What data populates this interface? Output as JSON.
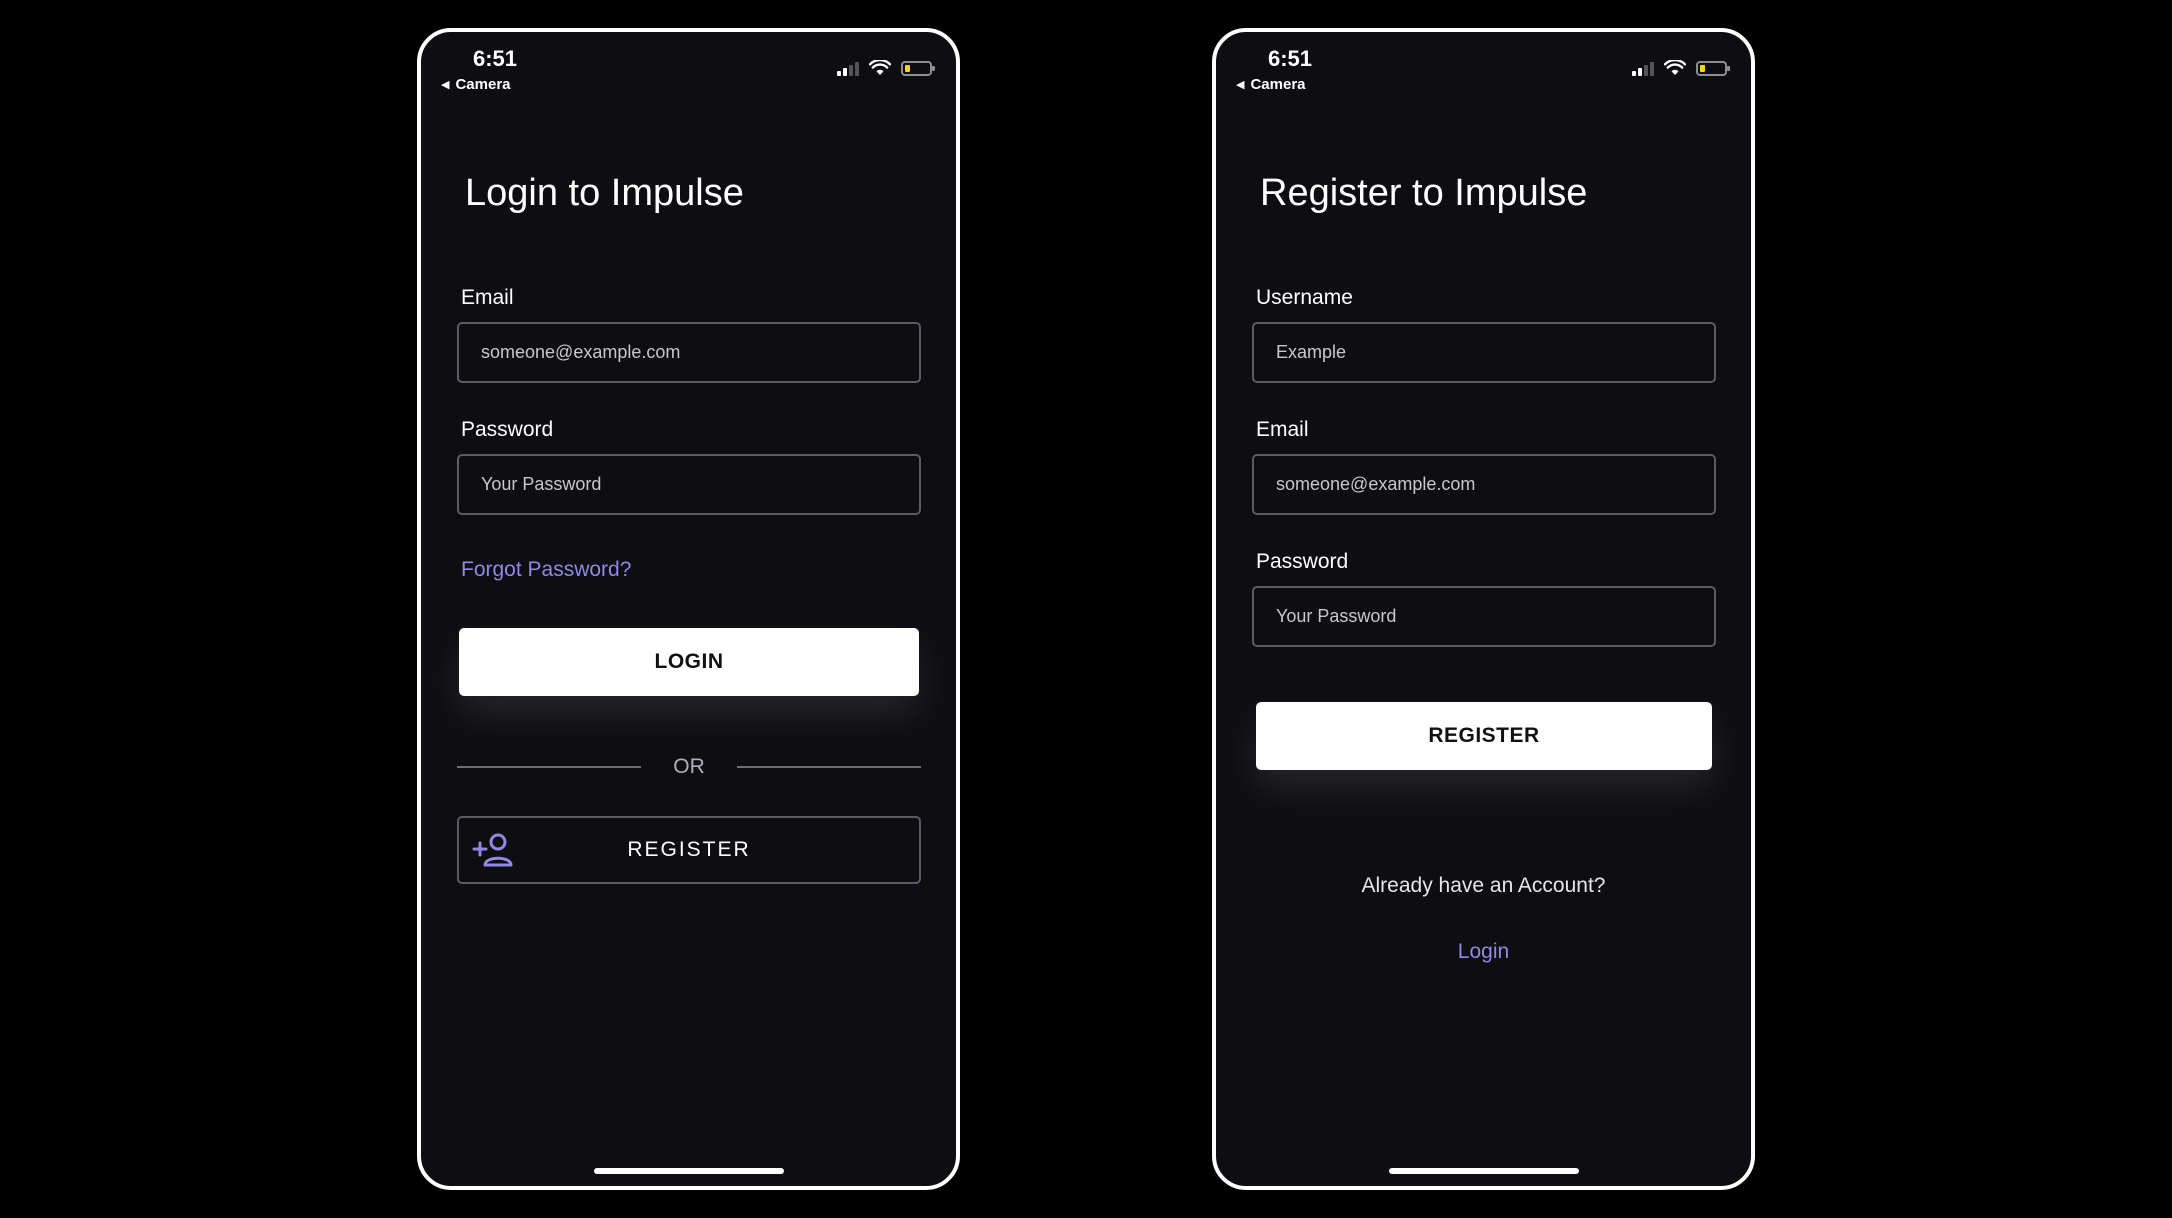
{
  "status_bar": {
    "time": "6:51",
    "back_label": "Camera",
    "signal_bars_active": 2,
    "battery_color": "#ffd60a"
  },
  "login_screen": {
    "title": "Login to Impulse",
    "email_label": "Email",
    "email_placeholder": "someone@example.com",
    "password_label": "Password",
    "password_placeholder": "Your Password",
    "forgot_password": "Forgot Password?",
    "login_button": "LOGIN",
    "divider_text": "OR",
    "register_button": "REGISTER",
    "register_icon": "add-person-icon"
  },
  "register_screen": {
    "title": "Register to Impulse",
    "username_label": "Username",
    "username_placeholder": "Example",
    "email_label": "Email",
    "email_placeholder": "someone@example.com",
    "password_label": "Password",
    "password_placeholder": "Your Password",
    "register_button": "REGISTER",
    "already_account": "Already have an Account?",
    "login_link": "Login"
  },
  "colors": {
    "background": "#000000",
    "screen": "#0e0d12",
    "accent": "#8f89e6",
    "input_border": "#5c5b65"
  }
}
